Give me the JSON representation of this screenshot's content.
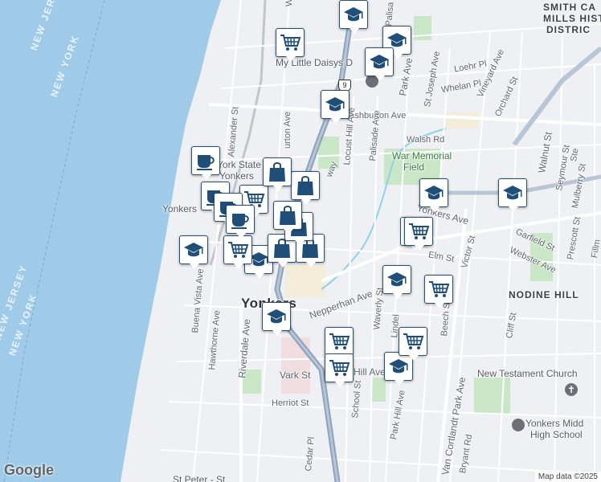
{
  "map": {
    "water_labels": [
      "NEW JERSEY",
      "NEW YORK"
    ],
    "city_label": "Yonkers",
    "neighborhoods": [
      "NODINE HILL"
    ],
    "district_label": [
      "SMITH CA",
      "MILLS HIST",
      "DISTRIC"
    ],
    "places": [
      "My Little Daisys D",
      "War Memorial",
      "Field",
      "New Testament Church",
      "Yonkers Midd",
      "High School",
      "St Peter - St.",
      "York State",
      "Yonkers"
    ],
    "streets": [
      "Ashburton Ave",
      "urton Ave",
      "Walsh Rd",
      "Loehr Pl",
      "Whelan Pl",
      "Park Ave",
      "St Joseph Ave",
      "Vineyard Ave",
      "Orchard St",
      "Walnut St",
      "Seymour St",
      "Mulberry St",
      "Locust Hill Ave",
      "Palisade Ave",
      "Alexander St",
      "Riverdale Ave",
      "Hawthorne Ave",
      "Buena Vista Ave",
      "Nepperhan Ave",
      "Vark St",
      "Hill Ave",
      "Herriot St",
      "Cedar Pl",
      "School St",
      "Park Hill Ave",
      "Van Cortlandt Park Ave",
      "Waverly St",
      "Beech St",
      "Victor St",
      "Garfield St",
      "Webster Ave",
      "Prescott St",
      "Elm St",
      "Cliff St",
      "Bryant Rd",
      "Yonkers Ave",
      "Lindel",
      "Ma",
      "way",
      "Wo",
      "Palisa",
      "Fillm",
      "Ste",
      "Yonkers"
    ],
    "route_shield": "9",
    "brand": "Google",
    "attribution": "Map data ©2025"
  },
  "markers": [
    {
      "type": "school",
      "icon": "graduation-cap-icon"
    },
    {
      "type": "school",
      "icon": "graduation-cap-icon"
    },
    {
      "type": "school",
      "icon": "graduation-cap-icon"
    },
    {
      "type": "school",
      "icon": "graduation-cap-icon"
    },
    {
      "type": "school",
      "icon": "graduation-cap-icon"
    },
    {
      "type": "school",
      "icon": "graduation-cap-icon"
    },
    {
      "type": "school",
      "icon": "graduation-cap-icon"
    },
    {
      "type": "school",
      "icon": "graduation-cap-icon"
    },
    {
      "type": "school",
      "icon": "graduation-cap-icon"
    },
    {
      "type": "school",
      "icon": "graduation-cap-icon"
    },
    {
      "type": "school",
      "icon": "graduation-cap-icon"
    },
    {
      "type": "grocery",
      "icon": "shopping-cart-icon"
    },
    {
      "type": "grocery",
      "icon": "shopping-cart-icon"
    },
    {
      "type": "grocery",
      "icon": "shopping-cart-icon"
    },
    {
      "type": "grocery",
      "icon": "shopping-cart-icon"
    },
    {
      "type": "grocery",
      "icon": "shopping-cart-icon"
    },
    {
      "type": "grocery",
      "icon": "shopping-cart-icon"
    },
    {
      "type": "grocery",
      "icon": "shopping-cart-icon"
    },
    {
      "type": "grocery",
      "icon": "shopping-cart-icon"
    },
    {
      "type": "grocery",
      "icon": "shopping-cart-icon"
    },
    {
      "type": "cafe",
      "icon": "coffee-cup-icon"
    },
    {
      "type": "cafe",
      "icon": "coffee-cup-icon"
    },
    {
      "type": "cafe",
      "icon": "coffee-cup-icon"
    },
    {
      "type": "cafe",
      "icon": "coffee-cup-icon"
    },
    {
      "type": "shopping",
      "icon": "shopping-bag-icon"
    },
    {
      "type": "shopping",
      "icon": "shopping-bag-icon"
    },
    {
      "type": "shopping",
      "icon": "shopping-bag-icon"
    },
    {
      "type": "shopping",
      "icon": "shopping-bag-icon"
    },
    {
      "type": "shopping",
      "icon": "shopping-bag-icon"
    },
    {
      "type": "shopping",
      "icon": "shopping-bag-icon"
    }
  ],
  "colors": {
    "water": "#9fcbe8",
    "land": "#eef0f3",
    "park": "#c9e7c6",
    "highway": "#8ea2bb",
    "marker_icon": "#1f4e79"
  }
}
